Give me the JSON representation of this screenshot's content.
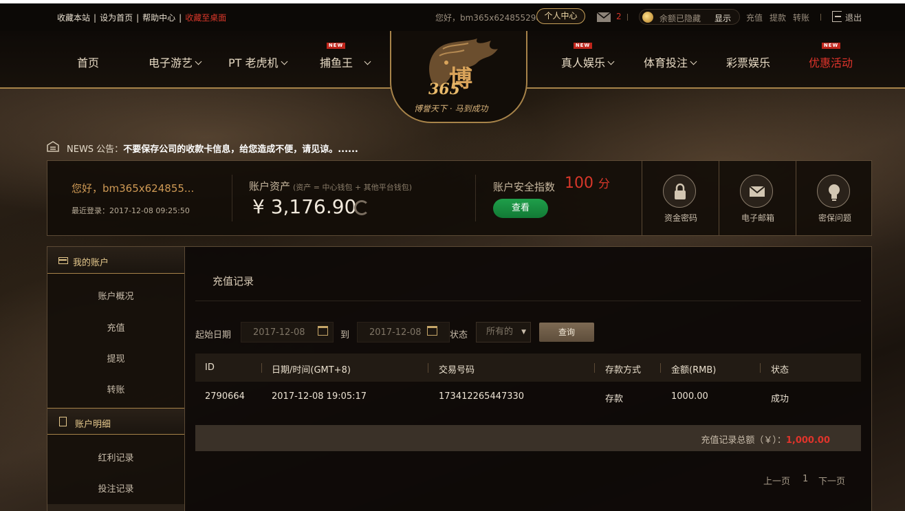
{
  "topbar": {
    "links": [
      "收藏本站",
      "设为首页",
      "帮助中心",
      "收藏至桌面"
    ],
    "greeting": "您好，bm365x624855298",
    "personal_center": "个人中心",
    "mail_count": "2",
    "balance_hidden_text": "余额已隐藏",
    "show_label": "显示",
    "quick_links": [
      "充值",
      "提款",
      "转账"
    ],
    "logout": "退出"
  },
  "nav": {
    "left_items": [
      {
        "label": "首页",
        "caret": false,
        "badge": ""
      },
      {
        "label": "电子游艺",
        "caret": true,
        "badge": ""
      },
      {
        "label": "PT 老虎机",
        "caret": true,
        "badge": ""
      },
      {
        "label": "捕鱼王",
        "caret": true,
        "badge": "NEW"
      }
    ],
    "right_items": [
      {
        "label": "真人娱乐",
        "caret": true,
        "badge": "NEW"
      },
      {
        "label": "体育投注",
        "caret": true,
        "badge": ""
      },
      {
        "label": "彩票娱乐",
        "caret": false,
        "badge": ""
      },
      {
        "label": "优惠活动",
        "caret": false,
        "badge": "NEW"
      }
    ],
    "logo": {
      "main": "博",
      "number": "365",
      "slogan": "博誉天下 · 马到成功"
    }
  },
  "news": {
    "label": "NEWS 公告：",
    "text": "不要保存公司的收款卡信息，给您造成不便，请见谅。......"
  },
  "summary": {
    "user": "您好，bm365x624855...",
    "last_login": "最近登录：2017-12-08 09:25:50",
    "asset_label": "账户资产",
    "asset_note": "(资产 = 中心钱包 + 其他平台钱包)",
    "asset_amount": "¥ 3,176.90",
    "security_label": "账户安全指数",
    "security_score": "100",
    "security_unit": "分",
    "view_button": "查看",
    "tiles": [
      {
        "label": "资金密码",
        "icon": "lock-icon"
      },
      {
        "label": "电子邮箱",
        "icon": "envelope-icon"
      },
      {
        "label": "密保问题",
        "icon": "lightbulb-icon"
      }
    ]
  },
  "sidebar": {
    "section1": "我的账户",
    "items1": [
      "账户概况",
      "充值",
      "提现",
      "转账"
    ],
    "section2": "账户明细",
    "items2": [
      "红利记录",
      "投注记录"
    ]
  },
  "main": {
    "title": "充值记录",
    "filter": {
      "start_label": "起始日期",
      "start_value": "2017-12-08",
      "to_label": "到",
      "end_value": "2017-12-08",
      "status_label": "状态",
      "status_value": "所有的",
      "query_button": "查询"
    },
    "table": {
      "headers": [
        "ID",
        "日期/时间(GMT+8)",
        "交易号码",
        "存款方式",
        "金额(RMB)",
        "状态"
      ],
      "rows": [
        [
          "2790664",
          "2017-12-08 19:05:17",
          "17341226544733​0",
          "存款",
          "1000.00",
          "成功"
        ]
      ]
    },
    "total_label": "充值记录总额（￥）：",
    "total_amount": "1,000.00",
    "pager": {
      "prev": "上一页",
      "page": "1",
      "next": "下一页"
    }
  },
  "colors": {
    "accent_gold": "#a8844a",
    "alert_red": "#d8372a",
    "view_green": "#1f9e4a"
  }
}
